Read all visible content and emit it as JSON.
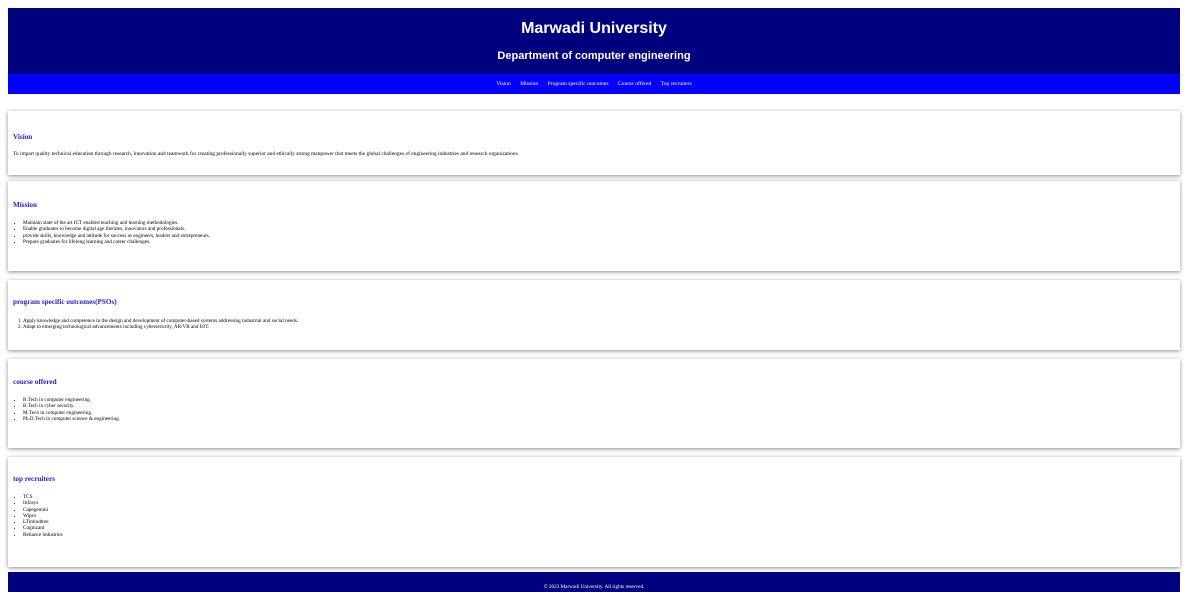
{
  "header": {
    "university": "Marwadi University",
    "department": "Department of computer engineering"
  },
  "nav": {
    "items": [
      "Vision",
      "Mission",
      "Program specific outcomes",
      "Course offered",
      "Top recruiters"
    ]
  },
  "vision": {
    "title": "Vision",
    "text": "To impart quality technical education through research, innovation and teamwork for creating professionally superior and ethically strong manpower that meets the global challenges of engineering industries and research organizations."
  },
  "mission": {
    "title": "Mission",
    "items": [
      "Maintain state of the art ICT enabled teaching and learning methodologies.",
      "Enable graduates to become digital age literates, innovators and professionals.",
      "provide skills, knowledge and attitude for success as engineers, leaders and entrepreneurs.",
      "Prepare graduates for lifelong learning and career challenges."
    ]
  },
  "pso": {
    "title": "program specific outcomes(PSOs)",
    "items": [
      "Apply knowledge and competence in the design and development of computer-based systems addressing industrial and social needs.",
      "Adapt to emerging technological advancements including cybersecurity, AR/VR and IOT."
    ]
  },
  "courses": {
    "title": "course offered",
    "items": [
      "B.Tech in computer engineering.",
      "B.Tech in cyber security.",
      "M.Tech in computer engineering.",
      "Ph.D.Tech in computer science & engineering."
    ]
  },
  "recruiters": {
    "title": "top recruiters",
    "items": [
      "TCS",
      "Infosys",
      "Capegemini",
      "Wipro",
      "LTimindtree",
      "Cognizant",
      "Reliance industries"
    ]
  },
  "footer": {
    "text": "© 2023 Marwadi University. All rights reserved."
  }
}
